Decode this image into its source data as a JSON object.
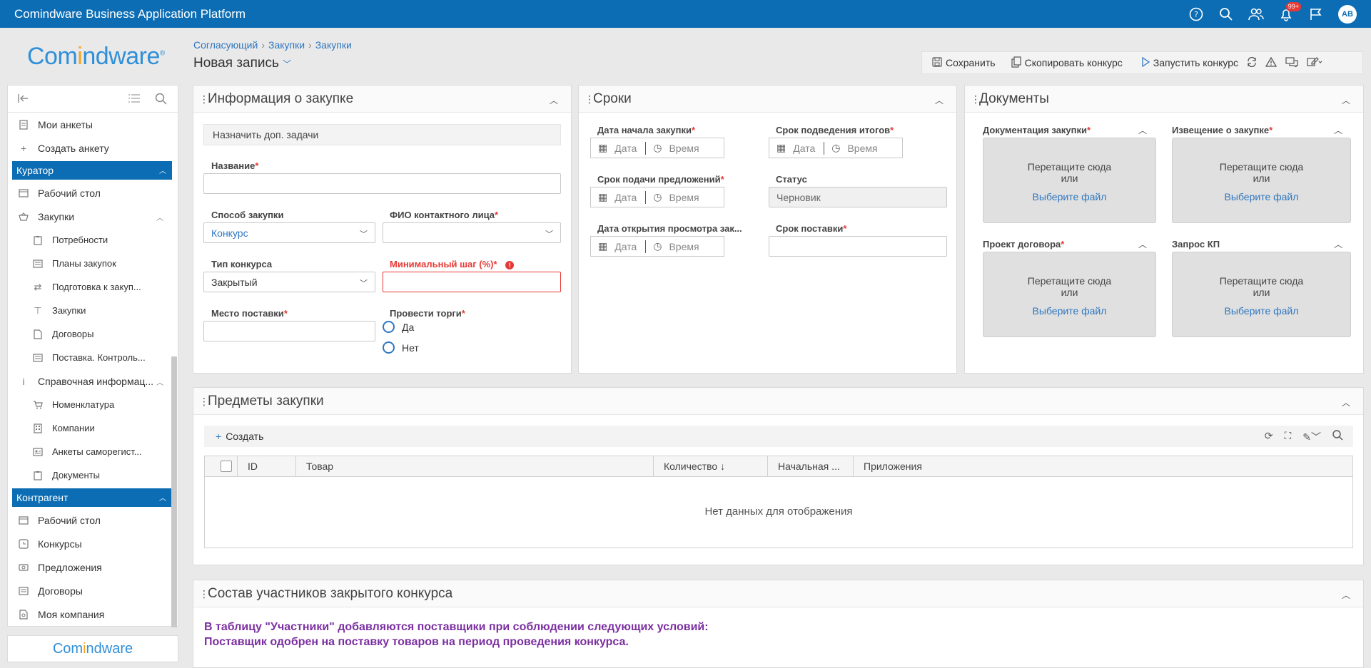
{
  "app": {
    "title": "Comindware Business Application Platform",
    "notif_badge": "99+",
    "avatar": "AB"
  },
  "logo": {
    "text_a": "Com",
    "text_b": "i",
    "text_c": "ndware",
    "mark": "®"
  },
  "bottom_logo": {
    "a": "Com",
    "b": "i",
    "c": "ndware"
  },
  "breadcrumb": [
    "Согласующий",
    "Закупки",
    "Закупки"
  ],
  "page_title": "Новая запись",
  "toolbar": {
    "save": "Сохранить",
    "copy": "Скопировать конкурс",
    "start": "Запустить конкурс"
  },
  "sidebar": {
    "top_items": [
      "Мои анкеты",
      "Создать анкету"
    ],
    "group1": "Куратор",
    "g1_items": [
      "Рабочий стол",
      "Закупки"
    ],
    "g1_sub": [
      "Потребности",
      "Планы закупок",
      "Подготовка к закуп...",
      "Закупки",
      "Договоры",
      "Поставка. Контроль..."
    ],
    "ref": "Справочная информац...",
    "ref_sub": [
      "Номенклатура",
      "Компании",
      "Анкеты саморегист...",
      "Документы"
    ],
    "group2": "Контрагент",
    "g2_items": [
      "Рабочий стол",
      "Конкурсы",
      "Предложения",
      "Договоры",
      "Моя компания"
    ]
  },
  "info": {
    "title": "Информация о закупке",
    "assign": "Назначить доп. задачи",
    "name_label": "Название",
    "method_label": "Способ закупки",
    "method_value": "Конкурс",
    "contact_label": "ФИО контактного лица",
    "type_label": "Тип конкурса",
    "type_value": "Закрытый",
    "minstep_label": "Минимальный шаг (%)",
    "place_label": "Место поставки",
    "auction_label": "Провести торги",
    "yes": "Да",
    "no": "Нет"
  },
  "terms": {
    "title": "Сроки",
    "start_label": "Дата начала закупки",
    "summary_label": "Срок подведения итогов",
    "submit_label": "Срок подачи предложений",
    "status_label": "Статус",
    "status_value": "Черновик",
    "open_label": "Дата открытия просмотра зак...",
    "delivery_label": "Срок поставки",
    "date_ph": "Дата",
    "time_ph": "Время"
  },
  "docs": {
    "title": "Документы",
    "items": [
      "Документация закупки",
      "Извещение о закупке",
      "Проект договора",
      "Запрос КП"
    ],
    "drop1": "Перетащите сюда",
    "drop2": "или",
    "choose": "Выберите файл"
  },
  "items": {
    "title": "Предметы закупки",
    "create": "Создать",
    "columns": [
      "ID",
      "Товар",
      "Количество ↓",
      "Начальная ...",
      "Приложения"
    ],
    "empty": "Нет данных для отображения"
  },
  "participants": {
    "title": "Состав участников закрытого конкурса",
    "line1": "В таблицу \"Участники\" добавляются поставщики при соблюдении следующих условий:",
    "line2": "Поставщик одобрен на поставку товаров на период проведения конкурса."
  }
}
